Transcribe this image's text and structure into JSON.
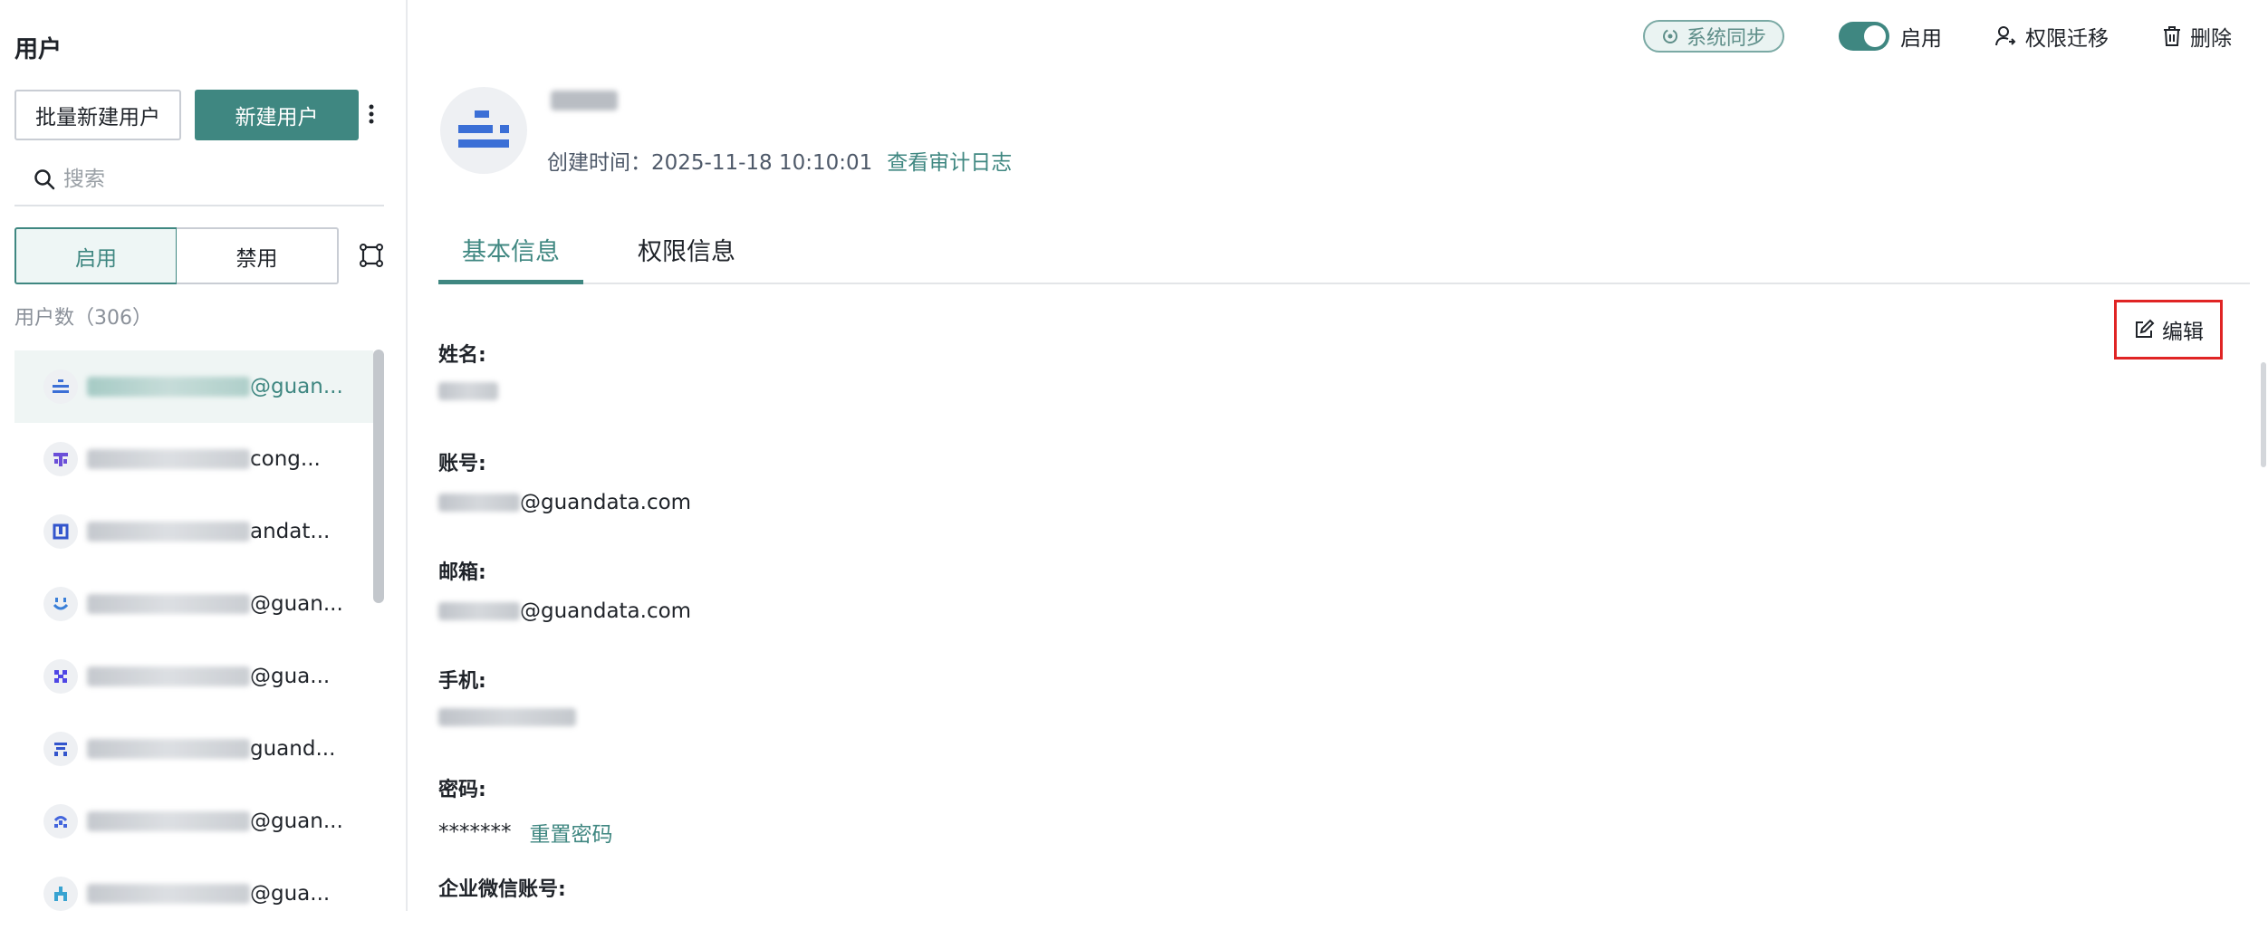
{
  "sidebar": {
    "title": "用户",
    "batch_new_label": "批量新建用户",
    "new_label": "新建用户",
    "search_placeholder": "搜索",
    "seg_enabled": "启用",
    "seg_disabled": "禁用",
    "user_count": "用户数（306）",
    "users": [
      {
        "visible_suffix": "@guan...",
        "active": true,
        "icon": "equal-bars-icon",
        "color": "#3b6fd6"
      },
      {
        "visible_suffix": "cong...",
        "active": false,
        "icon": "cross-glyph-icon",
        "color": "#6b4fd8"
      },
      {
        "visible_suffix": "andat...",
        "active": false,
        "icon": "box-glyph-icon",
        "color": "#3355cc"
      },
      {
        "visible_suffix": "@guan...",
        "active": false,
        "icon": "smile-glyph-icon",
        "color": "#3a7fd8"
      },
      {
        "visible_suffix": "@gua...",
        "active": false,
        "icon": "grid-glyph-icon",
        "color": "#4f46e5"
      },
      {
        "visible_suffix": "guand...",
        "active": false,
        "icon": "stack-glyph-icon",
        "color": "#3355cc"
      },
      {
        "visible_suffix": "@guan...",
        "active": false,
        "icon": "link-glyph-icon",
        "color": "#4466dd"
      },
      {
        "visible_suffix": "@gua...",
        "active": false,
        "icon": "puzzle-glyph-icon",
        "color": "#38a3d1"
      }
    ]
  },
  "topbar": {
    "sync_label": "系统同步",
    "toggle_label": "启用",
    "transfer_label": "权限迁移",
    "delete_label": "删除"
  },
  "profile": {
    "created_label": "创建时间：",
    "created_value": "2025-11-18 10:10:01",
    "audit_link": "查看审计日志"
  },
  "tabs": {
    "basic": "基本信息",
    "permission": "权限信息"
  },
  "edit_label": "编辑",
  "fields": {
    "name_label": "姓名:",
    "account_label": "账号:",
    "account_suffix": "@guandata.com",
    "email_label": "邮箱:",
    "email_suffix": "@guandata.com",
    "phone_label": "手机:",
    "password_label": "密码:",
    "password_value": "*******",
    "reset_link": "重置密码",
    "wecom_label": "企业微信账号:"
  },
  "colors": {
    "accent": "#3f8781",
    "highlight": "#e02424"
  }
}
